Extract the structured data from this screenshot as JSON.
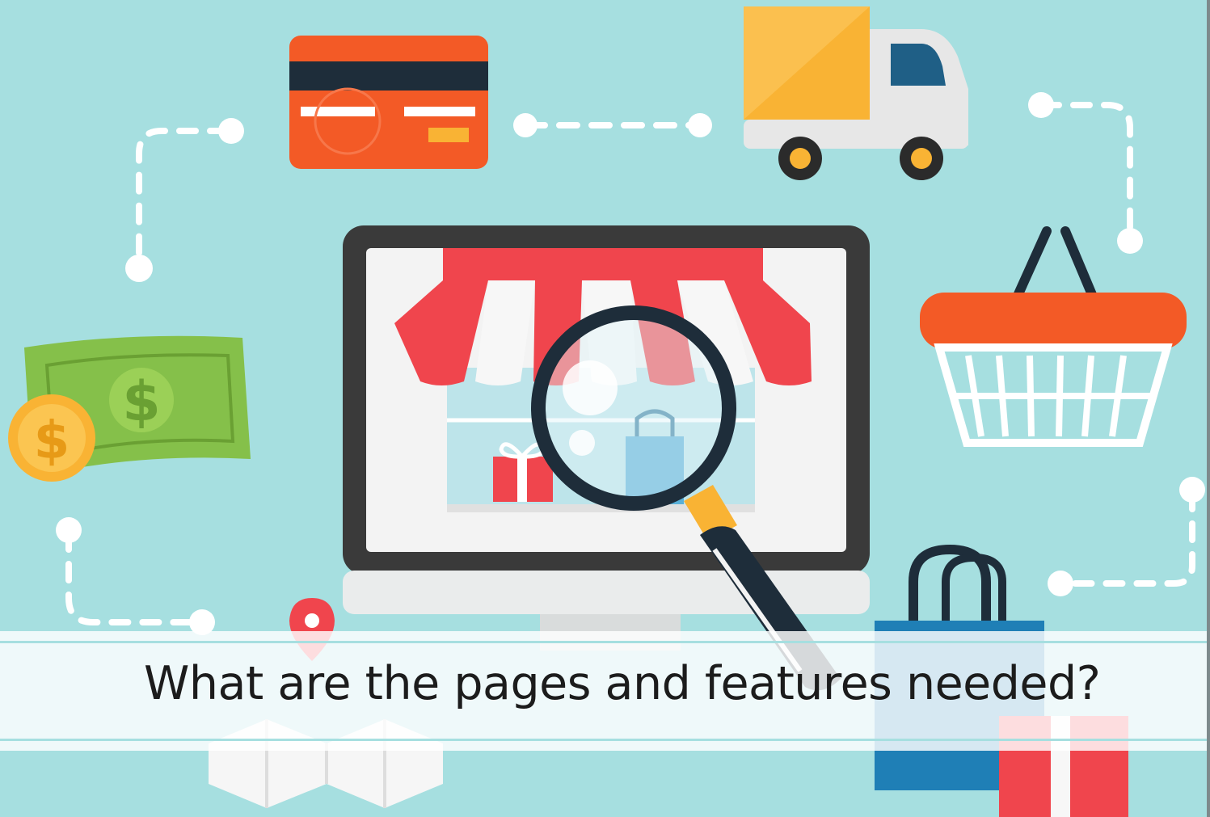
{
  "caption": {
    "text": "What are the pages and features needed?"
  },
  "illustration": {
    "background_color": "#a6dfe0",
    "icons": [
      "credit-card-icon",
      "delivery-truck-icon",
      "shopping-basket-icon",
      "money-icon",
      "coin-icon",
      "monitor-icon",
      "storefront-awning-icon",
      "magnifying-glass-icon",
      "shopping-bag-icon",
      "gift-box-icon",
      "location-pin-icon",
      "map-icon"
    ],
    "coin_symbol": "$",
    "bill_symbol": "$",
    "colors": {
      "accent_red": "#f0454d",
      "accent_orange": "#f35a26",
      "accent_yellow": "#f9b334",
      "dark": "#1e2d3a",
      "money_green": "#85c04a"
    }
  }
}
